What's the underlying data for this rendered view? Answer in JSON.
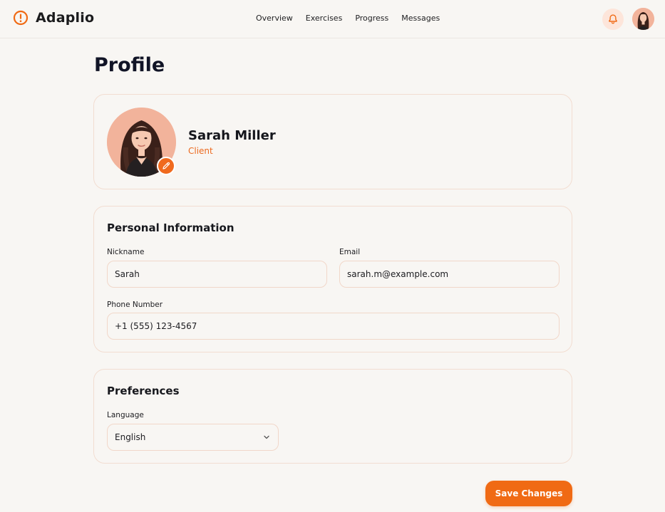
{
  "app": {
    "name": "Adaplio",
    "brand_color": "#f06a14"
  },
  "nav": {
    "items": [
      "Overview",
      "Exercises",
      "Progress",
      "Messages"
    ]
  },
  "header": {
    "notifications_icon": "bell-icon",
    "avatar_icon": "user-avatar"
  },
  "page": {
    "title": "Profile"
  },
  "profile": {
    "name": "Sarah Miller",
    "role": "Client",
    "edit_icon": "pencil-icon"
  },
  "personal_info": {
    "title": "Personal Information",
    "nickname_label": "Nickname",
    "nickname_value": "Sarah",
    "email_label": "Email",
    "email_value": "sarah.m@example.com",
    "phone_label": "Phone Number",
    "phone_value": "+1 (555) 123-4567"
  },
  "preferences": {
    "title": "Preferences",
    "language_label": "Language",
    "language_value": "English",
    "dropdown_icon": "chevron-down-icon"
  },
  "actions": {
    "save_label": "Save Changes"
  }
}
